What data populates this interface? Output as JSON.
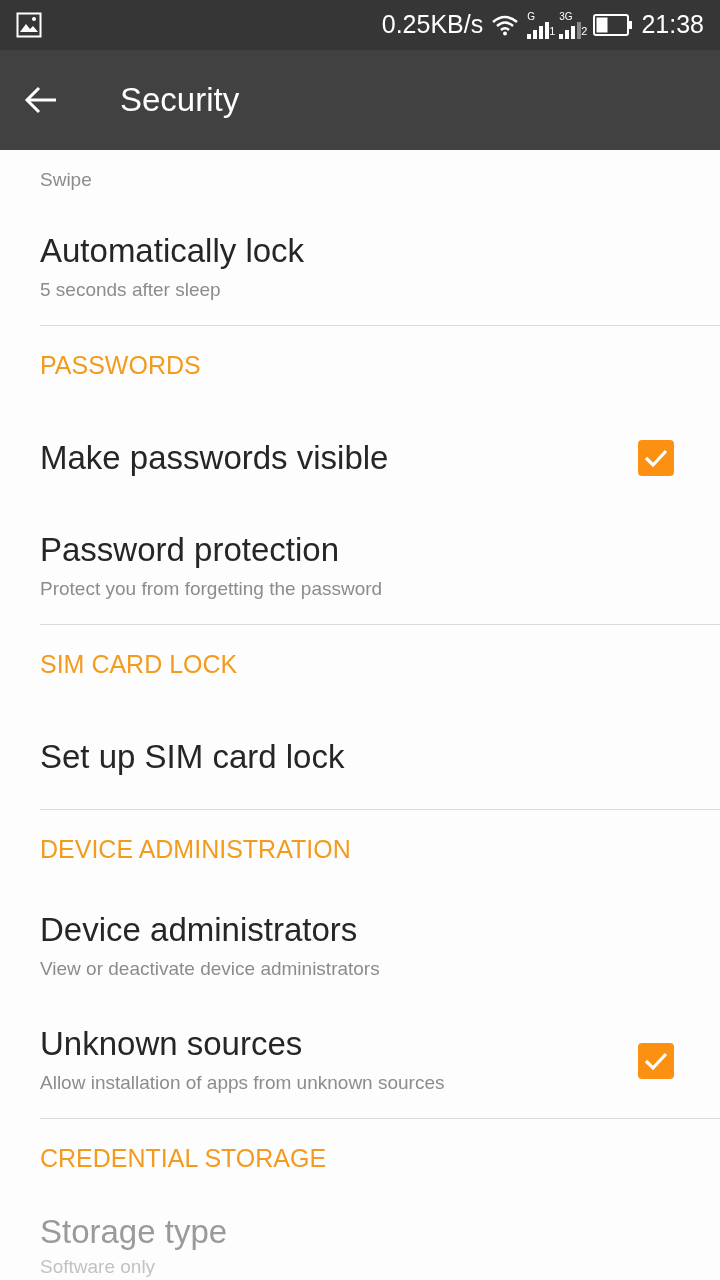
{
  "status_bar": {
    "speed": "0.25KB/s",
    "sim1_network": "G",
    "sim1_slot": "1",
    "sim2_network": "3G",
    "sim2_slot": "2",
    "time": "21:38"
  },
  "app_bar": {
    "title": "Security"
  },
  "sections": [
    {
      "items": [
        {
          "kind": "text",
          "summary": "Swipe",
          "disabled": false
        },
        {
          "kind": "text",
          "title": "Automatically lock",
          "summary": "5 seconds after sleep",
          "disabled": false
        }
      ]
    },
    {
      "header": "PASSWORDS",
      "items": [
        {
          "kind": "checkbox",
          "title": "Make passwords visible",
          "checked": true,
          "disabled": false
        },
        {
          "kind": "text",
          "title": "Password protection",
          "summary": "Protect you from forgetting the password",
          "disabled": false
        }
      ]
    },
    {
      "header": "SIM CARD LOCK",
      "items": [
        {
          "kind": "text",
          "title": "Set up SIM card lock",
          "disabled": false
        }
      ]
    },
    {
      "header": "DEVICE ADMINISTRATION",
      "items": [
        {
          "kind": "text",
          "title": "Device administrators",
          "summary": "View or deactivate device administrators",
          "disabled": false
        },
        {
          "kind": "checkbox",
          "title": "Unknown sources",
          "summary": "Allow installation of apps from unknown sources",
          "checked": true,
          "disabled": false
        }
      ]
    },
    {
      "header": "CREDENTIAL STORAGE",
      "items": [
        {
          "kind": "text",
          "title": "Storage type",
          "summary": "Software only",
          "disabled": true
        }
      ]
    }
  ]
}
